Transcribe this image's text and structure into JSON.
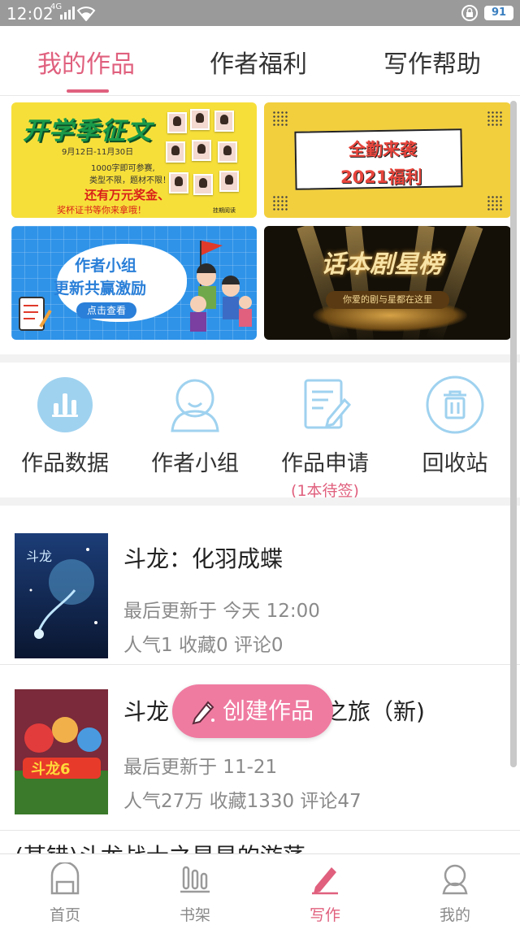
{
  "statusbar": {
    "time": "12:02",
    "network": "4G",
    "battery": "91"
  },
  "tabs": [
    {
      "label": "我的作品",
      "active": true
    },
    {
      "label": "作者福利",
      "active": false
    },
    {
      "label": "写作帮助",
      "active": false
    }
  ],
  "banners": {
    "b1": {
      "title": "开学季征文",
      "dates": "9月12日-11月30日",
      "line1": "1000字即可参赛,",
      "line2": "类型不限，题材不限！",
      "line3": "还有万元奖金、",
      "line4": "奖杯证书等你来拿哦！",
      "brand": "挂期阅读"
    },
    "b2": {
      "title1": "全勤来袭",
      "title2": "2021福利"
    },
    "b3": {
      "title1": "作者小组",
      "title2": "更新共赢激励",
      "button": "点击查看"
    },
    "b4": {
      "title": "话本剧星榜",
      "sub": "你爱的剧与星都在这里"
    }
  },
  "quick": [
    {
      "label": "作品数据",
      "icon": "bar-chart-icon"
    },
    {
      "label": "作者小组",
      "icon": "group-icon"
    },
    {
      "label": "作品申请",
      "icon": "form-edit-icon",
      "sub": "(1本待签)"
    },
    {
      "label": "回收站",
      "icon": "trash-icon"
    }
  ],
  "works": [
    {
      "title": "斗龙：化羽成蝶",
      "updated": "最后更新于 今天 12:00",
      "stats": "人气1 收藏0 评论0"
    },
    {
      "title_left": "斗龙",
      "title_right": "之旅（新)",
      "updated": "最后更新于 11-21",
      "stats": "人气27万 收藏1330 评论47"
    }
  ],
  "partial_row": "(某错)斗龙战士之星星的游荡",
  "fab": {
    "label": "创建作品"
  },
  "nav": [
    {
      "label": "首页",
      "icon": "home-icon"
    },
    {
      "label": "书架",
      "icon": "bookshelf-icon"
    },
    {
      "label": "写作",
      "icon": "pen-icon",
      "active": true
    },
    {
      "label": "我的",
      "icon": "profile-icon"
    }
  ],
  "colors": {
    "accent": "#e0607e",
    "fab": "#ef7ba1",
    "icon_blue": "#9fd2ef"
  }
}
